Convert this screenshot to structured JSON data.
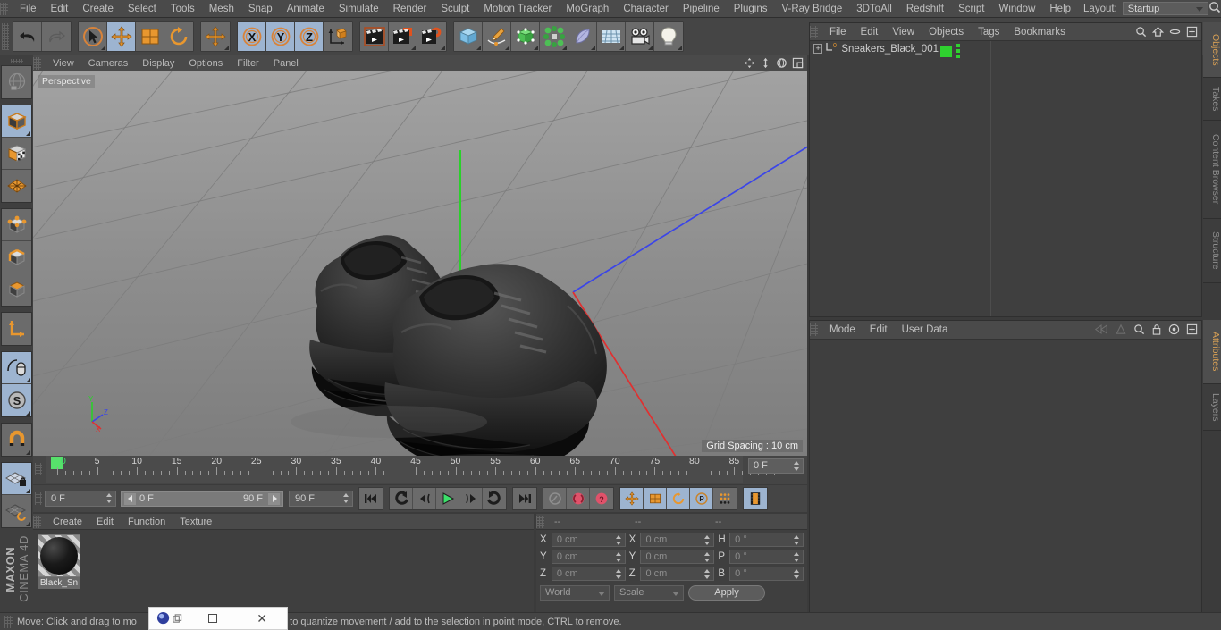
{
  "menubar": {
    "items": [
      "File",
      "Edit",
      "Create",
      "Select",
      "Tools",
      "Mesh",
      "Snap",
      "Animate",
      "Simulate",
      "Render",
      "Sculpt",
      "Motion Tracker",
      "MoGraph",
      "Character",
      "Pipeline",
      "Plugins",
      "V-Ray Bridge",
      "3DToAll",
      "Redshift",
      "Script",
      "Window",
      "Help"
    ],
    "layout_label": "Layout:",
    "layout_value": "Startup",
    "search_icon": "search-icon"
  },
  "toolbar": {
    "groups": [
      {
        "name": "history",
        "buttons": [
          {
            "name": "undo-button",
            "icon": "undo-arrow-icon",
            "active": false
          },
          {
            "name": "redo-button",
            "icon": "redo-arrow-icon",
            "active": false
          }
        ]
      },
      {
        "name": "transform-tools",
        "buttons": [
          {
            "name": "live-selection-tool",
            "icon": "cursor-circle-icon",
            "active": false
          },
          {
            "name": "move-tool",
            "icon": "move-cross-icon",
            "active": true
          },
          {
            "name": "scale-tool",
            "icon": "scale-box-icon",
            "active": false
          },
          {
            "name": "rotate-tool",
            "icon": "rotate-circle-icon",
            "active": false
          }
        ]
      },
      {
        "name": "move-single",
        "buttons": [
          {
            "name": "move-tool-alt",
            "icon": "move-cross-icon",
            "active": false
          }
        ]
      },
      {
        "name": "axis-locks",
        "buttons": [
          {
            "name": "lock-x-axis",
            "icon": "x-axis-icon",
            "label": "X",
            "active": true
          },
          {
            "name": "lock-y-axis",
            "icon": "y-axis-icon",
            "label": "Y",
            "active": true
          },
          {
            "name": "lock-z-axis",
            "icon": "z-axis-icon",
            "label": "Z",
            "active": true
          },
          {
            "name": "world-object-coordinates",
            "icon": "world-axis-cube-icon",
            "active": false
          }
        ]
      },
      {
        "name": "render-tools",
        "buttons": [
          {
            "name": "render-view-button",
            "icon": "clapperboard-icon",
            "active": false
          },
          {
            "name": "render-to-picture-viewer-button",
            "icon": "clapperboard-picture-icon",
            "active": false
          },
          {
            "name": "render-settings-button",
            "icon": "clapperboard-gear-icon",
            "active": false
          }
        ]
      },
      {
        "name": "create-tools",
        "buttons": [
          {
            "name": "add-cube-button",
            "icon": "blue-cube-icon",
            "active": false
          },
          {
            "name": "add-spline-button",
            "icon": "pen-spline-icon",
            "active": false
          },
          {
            "name": "add-generator-button",
            "icon": "green-cube-icon",
            "active": false
          },
          {
            "name": "add-mograph-button",
            "icon": "green-cluster-icon",
            "active": false
          },
          {
            "name": "add-deformer-button",
            "icon": "bend-deformer-icon",
            "active": false
          },
          {
            "name": "add-scene-object-button",
            "icon": "floor-grid-icon",
            "active": false
          },
          {
            "name": "add-camera-button",
            "icon": "camera-icon",
            "active": false
          },
          {
            "name": "add-light-button",
            "icon": "lightbulb-icon",
            "active": false
          }
        ]
      }
    ]
  },
  "leftbar": {
    "groups": [
      {
        "buttons": [
          {
            "name": "make-editable-button",
            "icon": "globe-mesh-icon",
            "active": false
          }
        ]
      },
      {
        "buttons": [
          {
            "name": "model-mode-button",
            "icon": "model-cube-icon",
            "active": true
          },
          {
            "name": "texture-mode-button",
            "icon": "texture-cube-icon",
            "active": false
          },
          {
            "name": "workplane-mode-button",
            "icon": "workplane-grid-icon",
            "active": false
          }
        ]
      },
      {
        "buttons": [
          {
            "name": "points-mode-button",
            "icon": "points-cube-icon",
            "active": false
          },
          {
            "name": "edges-mode-button",
            "icon": "edges-cube-icon",
            "active": false
          },
          {
            "name": "polygons-mode-button",
            "icon": "polygons-cube-icon",
            "active": false
          }
        ]
      },
      {
        "buttons": [
          {
            "name": "object-axis-mode-button",
            "icon": "axis-arrows-icon",
            "active": false
          }
        ]
      },
      {
        "buttons": [
          {
            "name": "enable-snapping-button",
            "icon": "mouse-snap-icon",
            "active": true
          },
          {
            "name": "auto-snapping-button",
            "icon": "snap-s-icon",
            "active": true
          }
        ]
      },
      {
        "buttons": [
          {
            "name": "magnet-tool-button",
            "icon": "magnet-icon",
            "active": false
          }
        ]
      },
      {
        "buttons": [
          {
            "name": "workplane-lock-button",
            "icon": "grid-lock-icon",
            "active": true
          },
          {
            "name": "planar-workplane-button",
            "icon": "grid-rotate-icon",
            "active": false
          }
        ]
      }
    ],
    "brand_bold": "MAXON",
    "brand_light": "CINEMA 4D"
  },
  "viewport": {
    "menu": [
      "View",
      "Cameras",
      "Display",
      "Options",
      "Filter",
      "Panel"
    ],
    "nav_icons": [
      "pan-icon",
      "zoom-icon",
      "rotate-icon",
      "maximize-icon"
    ],
    "label": "Perspective",
    "grid_spacing": "Grid Spacing : 10 cm",
    "axis_labels": {
      "x": "X",
      "y": "Y",
      "z": "Z"
    },
    "scene_description": "Pair of black chunky sneakers on grey perspective grid"
  },
  "timeline": {
    "tick_labels": [
      "0",
      "5",
      "10",
      "15",
      "20",
      "25",
      "30",
      "35",
      "40",
      "45",
      "50",
      "55",
      "60",
      "65",
      "70",
      "75",
      "80",
      "85",
      "90"
    ],
    "current_frame_field": "0 F",
    "playhead_frame": 0
  },
  "transport": {
    "current_frame": "0 F",
    "range_start": "0 F",
    "range_end": "90 F",
    "max_frame": "90 F",
    "buttons": [
      {
        "name": "go-to-start-button",
        "icon": "skip-start-icon",
        "active": false
      },
      {
        "name": "go-to-previous-key-button",
        "icon": "prev-key-icon",
        "active": false
      },
      {
        "name": "step-back-button",
        "icon": "step-back-icon",
        "active": false
      },
      {
        "name": "play-button",
        "icon": "play-icon",
        "active": false
      },
      {
        "name": "step-forward-button",
        "icon": "step-forward-icon",
        "active": false
      },
      {
        "name": "go-to-next-key-button",
        "icon": "next-key-icon",
        "active": false
      },
      {
        "name": "go-to-end-button",
        "icon": "skip-end-icon",
        "active": false
      }
    ],
    "key_buttons": [
      {
        "name": "autokeying-button",
        "icon": "key-icon",
        "active": false
      },
      {
        "name": "record-active-objects-button",
        "icon": "record-circle-icon",
        "active": false
      },
      {
        "name": "keyframe-selection-button",
        "icon": "record-question-icon",
        "active": false
      }
    ],
    "record_toggles": [
      {
        "name": "record-position-button",
        "icon": "move-cross-icon",
        "active": true
      },
      {
        "name": "record-scale-button",
        "icon": "scale-box-icon",
        "active": true
      },
      {
        "name": "record-rotation-button",
        "icon": "rotate-circle-icon",
        "active": true
      },
      {
        "name": "record-pla-button",
        "icon": "pla-p-icon",
        "active": true
      },
      {
        "name": "record-parameter-button",
        "icon": "dots-grid-icon",
        "active": false
      },
      {
        "name": "timeline-view-button",
        "icon": "filmstrip-icon",
        "active": true
      }
    ]
  },
  "material_manager": {
    "menu": [
      "Create",
      "Edit",
      "Function",
      "Texture"
    ],
    "materials": [
      {
        "name": "Black_Sn",
        "swatch_color": "#0b0b0b"
      }
    ]
  },
  "coordinates": {
    "header": [
      "--",
      "--",
      "--"
    ],
    "rows": [
      {
        "pos_label": "X",
        "pos_value": "0 cm",
        "size_label": "X",
        "size_value": "0 cm",
        "rot_label": "H",
        "rot_value": "0 °"
      },
      {
        "pos_label": "Y",
        "pos_value": "0 cm",
        "size_label": "Y",
        "size_value": "0 cm",
        "rot_label": "P",
        "rot_value": "0 °"
      },
      {
        "pos_label": "Z",
        "pos_value": "0 cm",
        "size_label": "Z",
        "size_value": "0 cm",
        "rot_label": "B",
        "rot_value": "0 °"
      }
    ],
    "coord_system": "World",
    "mode": "Scale",
    "apply_label": "Apply"
  },
  "object_manager": {
    "menu": [
      "File",
      "Edit",
      "View",
      "Objects",
      "Tags",
      "Bookmarks"
    ],
    "icons": [
      "search-icon",
      "home-icon",
      "eye-icon",
      "expand-icon"
    ],
    "objects": [
      {
        "name": "Sneakers_Black_001",
        "layer_badge": "0",
        "tag_color": "#2fd12f"
      }
    ]
  },
  "attribute_manager": {
    "menu": [
      "Mode",
      "Edit",
      "User Data"
    ],
    "icons": [
      "history-back-icon",
      "history-forward-icon",
      "search-icon",
      "lock-icon",
      "target-icon",
      "expand-icon"
    ]
  },
  "vertical_tabs": {
    "top": [
      {
        "label": "Objects",
        "active": true
      },
      {
        "label": "Takes",
        "active": false
      },
      {
        "label": "Content Browser",
        "active": false
      },
      {
        "label": "Structure",
        "active": false
      }
    ],
    "bottom": [
      {
        "label": "Attributes",
        "active": true
      },
      {
        "label": "Layers",
        "active": false
      }
    ]
  },
  "statusbar": {
    "text_left": "Move: Click and drag to mo",
    "text_right": "FT to quantize movement / add to the selection in point mode, CTRL to remove."
  },
  "overlay_window": {
    "icon": "app-orb-icon",
    "restore_label": "restore-icon",
    "close_label": "✕"
  },
  "colors": {
    "accent_orange": "#e8972f",
    "active_blue": "#9db4d0",
    "panel_bg": "#3f3f3f",
    "toolbar_bg": "#454545",
    "green": "#2fd12f"
  }
}
